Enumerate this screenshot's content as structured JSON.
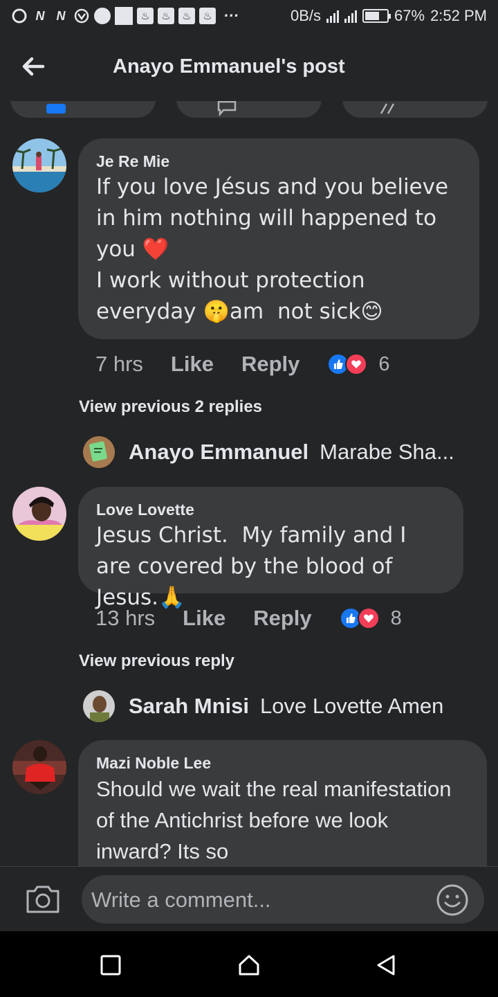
{
  "status_bar": {
    "network_speed": "0B/s",
    "battery": "67%",
    "battery_level": 0.67,
    "time": "2:52 PM"
  },
  "header": {
    "title": "Anayo Emmanuel's post"
  },
  "comments": [
    {
      "author": "Je Re Mie",
      "text": "If you love Jésus and you believe in him nothing will happened to you ❤️\nI work without protection everyday 🤫am  not sick😊",
      "time": "7 hrs",
      "like_label": "Like",
      "reply_label": "Reply",
      "reaction_count": "6",
      "view_previous": "View previous 2 replies",
      "latest_reply": {
        "author": "Anayo Emmanuel",
        "text": "Marabe Sha..."
      }
    },
    {
      "author": "Love Lovette",
      "text": "Jesus Christ.  My family and I are covered by the blood of Jesus.🙏",
      "time": "13 hrs",
      "like_label": "Like",
      "reply_label": "Reply",
      "reaction_count": "8",
      "view_previous": "View previous reply",
      "latest_reply": {
        "author": "Sarah Mnisi",
        "text": "Love Lovette  Amen"
      }
    },
    {
      "author": "Mazi Noble Lee",
      "text": "Should we wait the real manifestation of the Antichrist before we look inward? Its so"
    }
  ],
  "comment_bar": {
    "placeholder": "Write a comment..."
  },
  "icons": {
    "back": "arrow-left-icon",
    "camera": "camera-icon",
    "emoji": "smiley-icon",
    "nav_recent": "square-icon",
    "nav_home": "home-icon",
    "nav_back": "triangle-back-icon"
  },
  "colors": {
    "background": "#242526",
    "bubble": "#3a3b3c",
    "text_primary": "#e4e6eb",
    "text_secondary": "#b0b3b8",
    "like_blue": "#1877f2",
    "love_red": "#f33e58"
  }
}
